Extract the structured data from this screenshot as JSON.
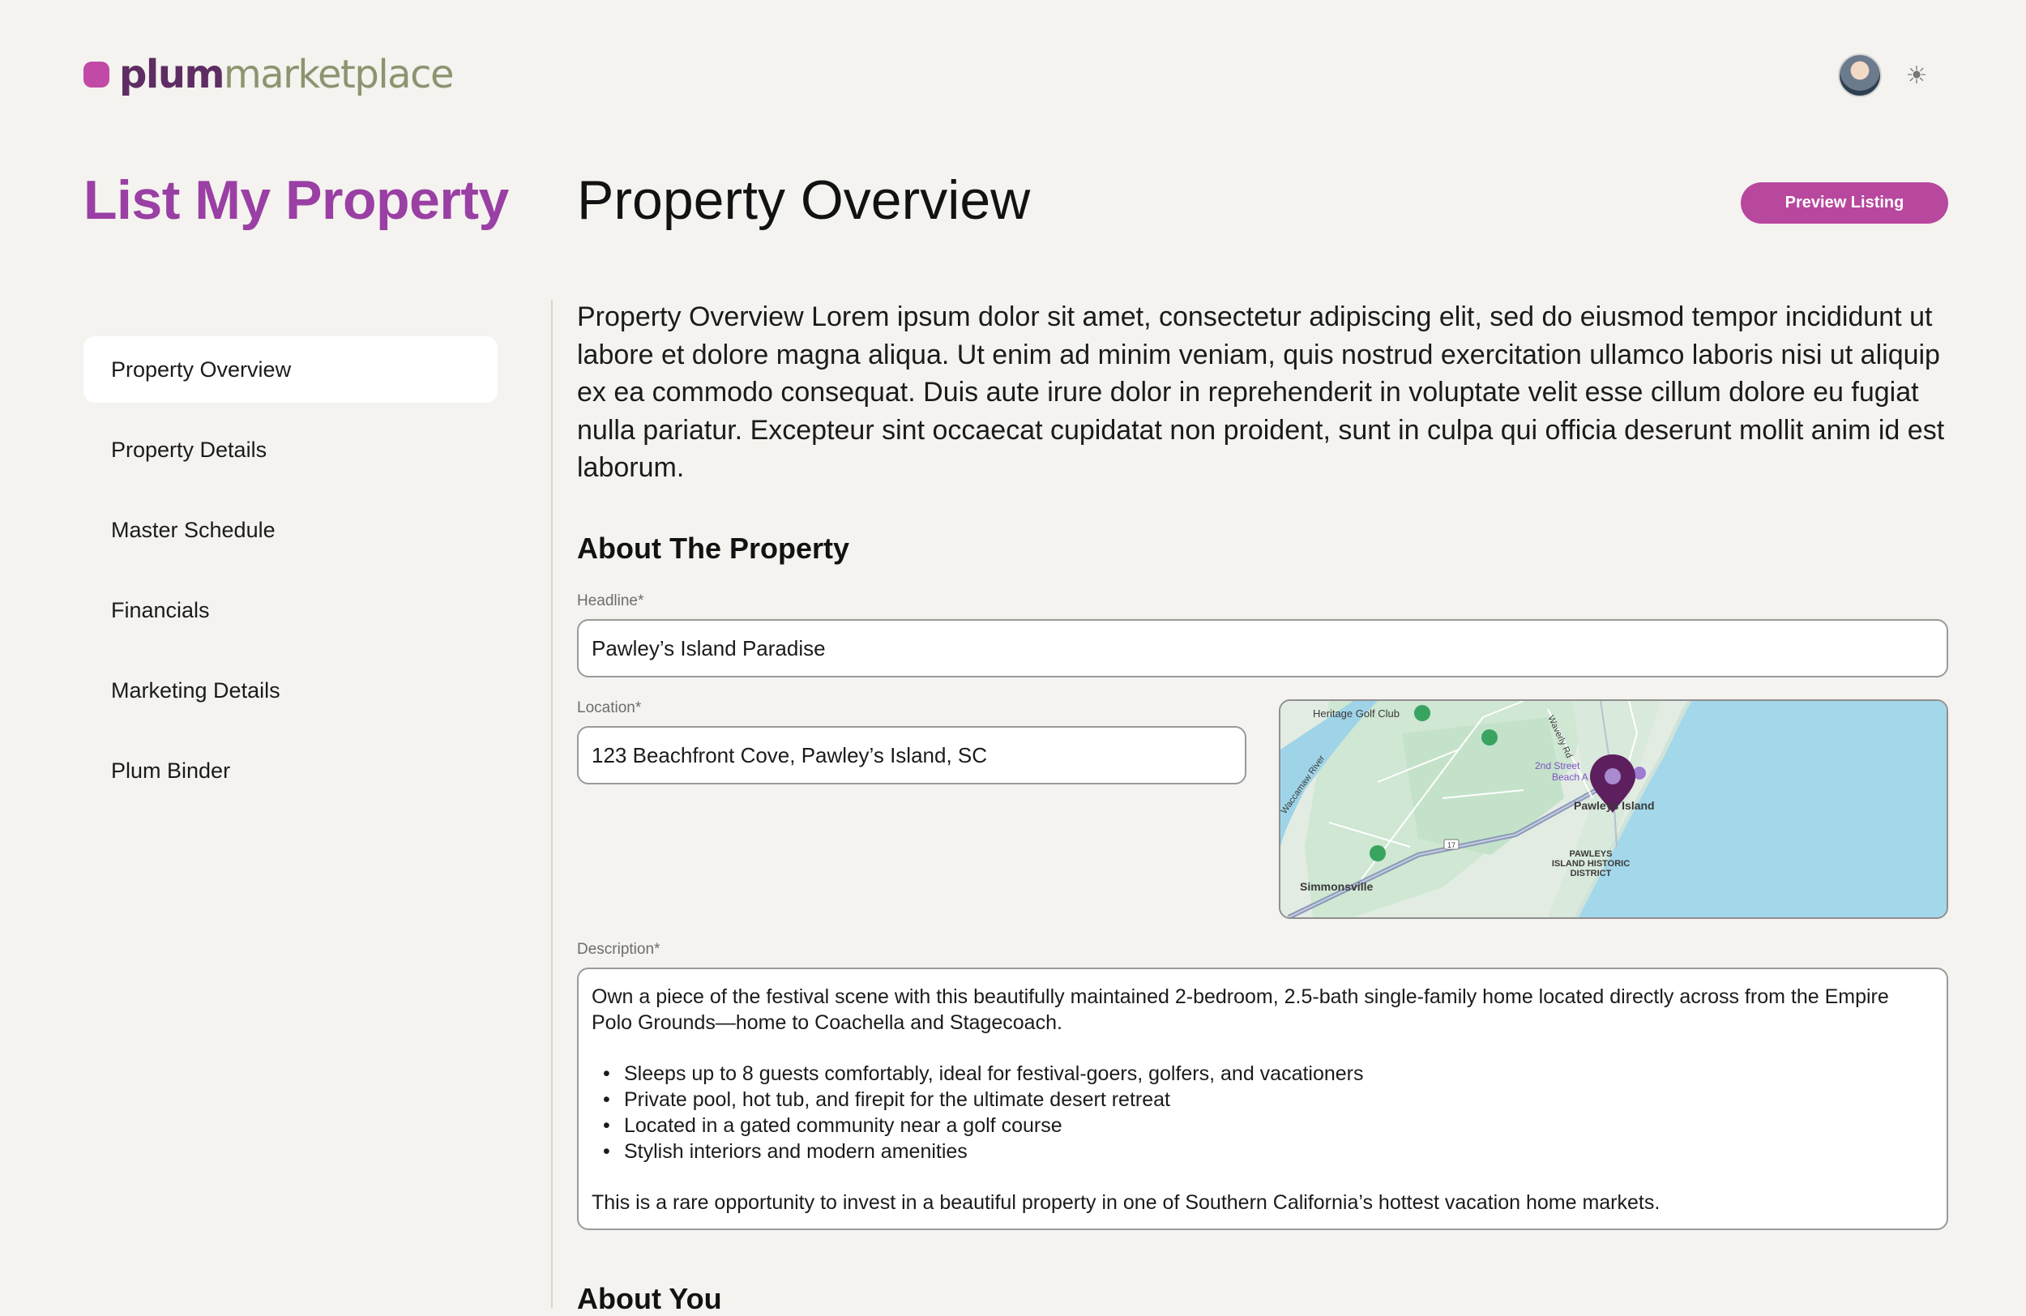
{
  "brand": {
    "name_bold": "plum",
    "name_light": "marketplace",
    "accent": "#c04aa6"
  },
  "header": {
    "avatar_icon": "user-avatar",
    "theme_icon": "sun-icon"
  },
  "sidebar": {
    "title": "List My Property",
    "items": [
      {
        "label": "Property Overview",
        "active": true
      },
      {
        "label": "Property Details"
      },
      {
        "label": "Master Schedule"
      },
      {
        "label": "Financials"
      },
      {
        "label": "Marketing Details"
      },
      {
        "label": "Plum Binder"
      }
    ]
  },
  "main": {
    "title": "Property Overview",
    "preview_label": "Preview Listing",
    "intro": "Property Overview Lorem ipsum dolor sit amet, consectetur adipiscing elit, sed do eiusmod tempor incididunt ut labore et dolore magna aliqua. Ut enim ad minim veniam, quis nostrud exercitation ullamco laboris nisi ut aliquip ex ea commodo consequat. Duis aute irure dolor in reprehenderit in voluptate velit esse cillum dolore eu fugiat nulla pariatur. Excepteur sint occaecat cupidatat non proident, sunt in culpa qui officia deserunt mollit anim id est laborum.",
    "about_heading": "About The Property",
    "headline": {
      "label": "Headline*",
      "value": "Pawley’s Island Paradise"
    },
    "location": {
      "label": "Location*",
      "value": "123 Beachfront Cove, Pawley’s Island, SC"
    },
    "map": {
      "labels": {
        "golf": "Heritage Golf Club",
        "island": "Pawleys Island",
        "street": "2nd Street",
        "beach": "Beach A",
        "district1": "PAWLEYS",
        "district2": "ISLAND HISTORIC",
        "district3": "DISTRICT",
        "town": "Simmonsville",
        "road": "Waverly Rd",
        "river": "Waccamaw River",
        "route": "17"
      }
    },
    "description": {
      "label": "Description*",
      "intro": "Own a piece of the festival scene with this beautifully maintained 2-bedroom, 2.5-bath single-family home located directly across from the Empire Polo Grounds—home to Coachella and Stagecoach.",
      "bullets": [
        "Sleeps up to 8 guests comfortably, ideal for festival-goers, golfers, and vacationers",
        "Private pool, hot tub, and firepit for the ultimate desert retreat",
        "Located in a gated community near a golf course",
        "Stylish interiors and modern amenities"
      ],
      "closing": "This is a rare opportunity to invest in a beautiful property in one of Southern California’s hottest vacation home markets."
    },
    "about_you_heading": "About You"
  }
}
